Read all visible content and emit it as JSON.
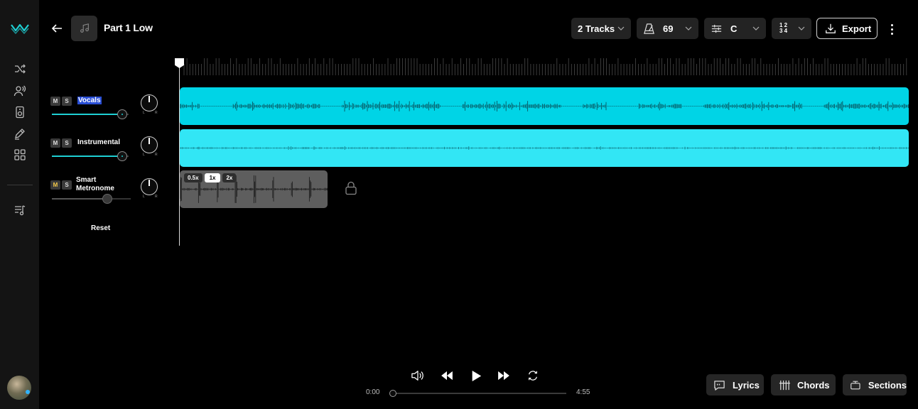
{
  "app": {
    "song_title": "Part 1 Low"
  },
  "sidebar": {
    "items": [
      {
        "name": "shuffle-icon"
      },
      {
        "name": "people-icon"
      },
      {
        "name": "speaker-icon"
      },
      {
        "name": "edit-icon"
      },
      {
        "name": "grid-icon"
      },
      {
        "name": "playlist-icon"
      }
    ]
  },
  "header": {
    "tracks_label": "2 Tracks",
    "tempo_value": "69",
    "key_value": "C",
    "time_signature_top": "1 2",
    "time_signature_bottom": "3 4",
    "export_label": "Export"
  },
  "tracks": [
    {
      "name": "Vocals",
      "mute": "M",
      "solo": "S",
      "volume": 0.92,
      "selected": true
    },
    {
      "name": "Instrumental",
      "mute": "M",
      "solo": "S",
      "volume": 0.92,
      "selected": false
    },
    {
      "name": "Smart Metronome",
      "mute": "M",
      "solo": "S",
      "volume": 0.7,
      "selected": false
    }
  ],
  "knob_labels": {
    "left": "L",
    "right": "R"
  },
  "reset_label": "Reset",
  "metronome": {
    "speeds": [
      "0.5x",
      "1x",
      "2x"
    ],
    "active_speed": "1x"
  },
  "transport": {
    "current_time": "0:00",
    "total_time": "4:55",
    "progress": 0
  },
  "bottom_tools": {
    "lyrics_label": "Lyrics",
    "chords_label": "Chords",
    "sections_label": "Sections"
  },
  "colors": {
    "vocals_lane": "#00d4e6",
    "instrumental_lane": "#32e6f5",
    "accent": "#1ecfd3"
  }
}
